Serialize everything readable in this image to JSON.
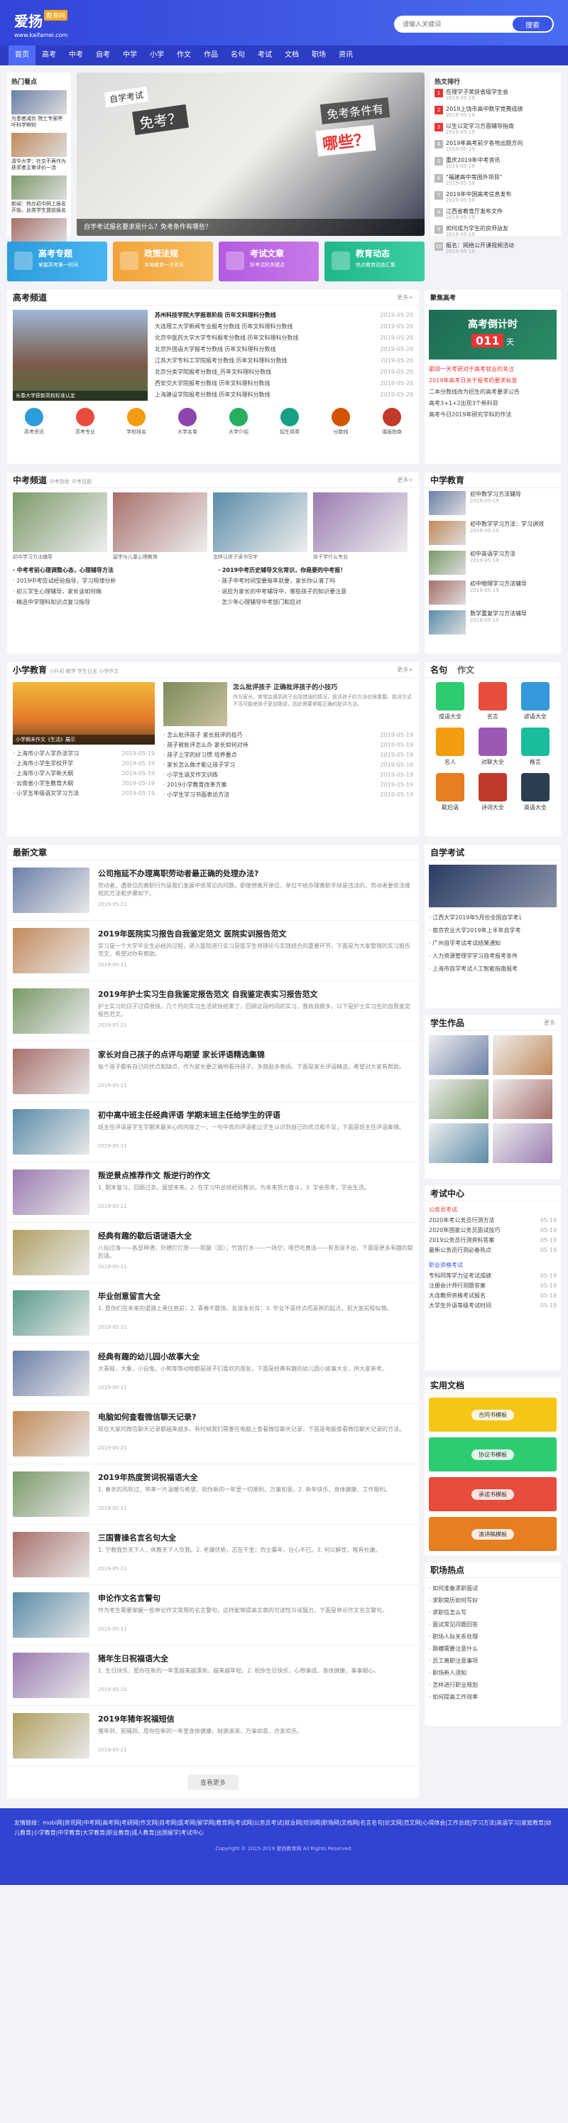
{
  "site": {
    "name": "爱扬",
    "tag": "教育网",
    "url": "www.kaifamei.com"
  },
  "search": {
    "placeholder": "请输入关键词",
    "button": "搜索"
  },
  "nav": [
    "首页",
    "高考",
    "中考",
    "自考",
    "中学",
    "小学",
    "作文",
    "作品",
    "名句",
    "考试",
    "文档",
    "职场",
    "资讯"
  ],
  "hot": {
    "title": "热门看点",
    "items": [
      {
        "t": "为患者减负 院士专家呼吁科学辨别"
      },
      {
        "t": "清华大学：社交不再作为获奖者主审评价一流"
      },
      {
        "t": "新闻：热办初中网上报名开始，此类学生提前报名"
      },
      {
        "t": "高考来啦招生名录省内哪些专业分数高"
      }
    ]
  },
  "banner": {
    "caption": "自学考试报名要求是什么？免考条件有哪些？",
    "line1": "自学考试",
    "line2": "免考？",
    "line3": "免考条件有",
    "line4": "哪些？"
  },
  "news_right": {
    "title": "热文排行",
    "items": [
      {
        "t": "在理学子荣获省级学生会",
        "d": "2019-05-19"
      },
      {
        "t": "2019上饶市高中数学竞赛成绩",
        "d": "2019-05-19"
      },
      {
        "t": "以生以定学习方面辅导指南",
        "d": "2019-05-19"
      },
      {
        "t": "2019年高考前夕各地出题方向",
        "d": "2019-05-19"
      },
      {
        "t": "重庆2019年中考资讯",
        "d": "2019-05-19"
      },
      {
        "t": "\"福建高中等国外项目\"",
        "d": "2019-05-19"
      },
      {
        "t": "2019年中国高考信息发布",
        "d": "2019-05-19"
      },
      {
        "t": "江西省教育厅发布文件",
        "d": "2019-05-19"
      },
      {
        "t": "如何成为学生的良师益友",
        "d": "2019-05-19"
      },
      {
        "t": "报名：网络公开课视频活动",
        "d": "2019-05-19"
      }
    ]
  },
  "quick": [
    {
      "t": "高考专题",
      "s": "掌握高考第一时间"
    },
    {
      "t": "政策法规",
      "s": "本地教育一手资讯"
    },
    {
      "t": "考试文章",
      "s": "好考试的关键点"
    },
    {
      "t": "教育动态",
      "s": "热点教育动态汇集"
    }
  ],
  "gaokao": {
    "title": "高考频道",
    "more": "更多+",
    "img_caption": "长春大学获新高校标准认定",
    "items": [
      {
        "t": "苏州科技学院大学报恩阶段 历年文科理科分数线",
        "d": "2019-05-20"
      },
      {
        "t": "大连理工大学新闻专业报考分数线 历年文科理科分数线",
        "d": "2019-05-20"
      },
      {
        "t": "北京中医药大学大学专科报考分数线 历年文科理科分数线",
        "d": "2019-05-20"
      },
      {
        "t": "北京外国语大学报考分数线 历年文科理科分数线",
        "d": "2019-05-20"
      },
      {
        "t": "江苏大学专科工学院报考分数线 历年文科理科分数线",
        "d": "2019-05-20"
      },
      {
        "t": "北京分类学院报考分数线_历年文科理科分数线",
        "d": "2019-05-20"
      },
      {
        "t": "西安交大学院报考分数线 历年文科理科分数线",
        "d": "2019-05-20"
      },
      {
        "t": "上海建设学院报考分数线 历年文科理科分数线",
        "d": "2019-05-20"
      }
    ],
    "icons": [
      "高考资讯",
      "高考专业",
      "学校排名",
      "大学名单",
      "大学介绍",
      "招生简章",
      "分数线",
      "填报指南"
    ]
  },
  "countdown": {
    "title": "聚焦高考",
    "label": "高考倒计时",
    "days": "011",
    "unit": "天",
    "items": [
      {
        "t": "歌颂一天考研对于高考就业的关注",
        "red": true
      },
      {
        "t": "2019年高考日关于留考的要求标准",
        "red": true
      },
      {
        "t": "二本分数线改为招生的高考要求公告",
        "red": false
      },
      {
        "t": "高考3+1+2出现3个新科目",
        "red": false
      },
      {
        "t": "高考今日2019年研究学科的作法",
        "red": false
      }
    ]
  },
  "zhongkao": {
    "title": "中考频道",
    "sub": [
      "中考指南",
      "中考百题"
    ],
    "more": "更多+",
    "pics": [
      "初中学习方法辅导",
      "留学与儿童心理教育",
      "怎样让孩子读书写字",
      "孩子学什么专业"
    ],
    "items": [
      {
        "t": "中考考前心理调整心态，心理辅导方法",
        "b": true
      },
      {
        "t": "2019中考应试经验指导，学习规律分析"
      },
      {
        "t": "初三学生心理辅导，家长该如何做"
      },
      {
        "t": "精选中学理科知识点复习指导"
      },
      {
        "t": "2019中考历史辅导文化常识，你是要的中考报！",
        "b": true
      },
      {
        "t": "孩子中考时间宝要每年就要，家长你认清了吗"
      },
      {
        "t": "说应为家长的中考辅导中，哪些孩子的知识要注意"
      },
      {
        "t": "怎少年心理辅导中考部门和应对"
      }
    ]
  },
  "zhongxue": {
    "title": "中学教育",
    "items": [
      {
        "t": "初中数学习方法辅导",
        "d": "2019-05-19"
      },
      {
        "t": "初中数学学习方法：学习讲效",
        "d": "2019-05-19"
      },
      {
        "t": "初中英语学习方法",
        "d": "2019-05-19"
      },
      {
        "t": "初中物理学习方法辅导",
        "d": "2019-05-19"
      },
      {
        "t": "数学重复学习方法辅导",
        "d": "2019-05-19"
      }
    ]
  },
  "xiaoxue": {
    "title": "小学教育",
    "sub": [
      "小升初",
      "教学",
      "学生日志",
      "小学作文"
    ],
    "more": "更多+",
    "feature": {
      "t": "怎么批评孩子 正确批评孩子的小技巧",
      "s": "作为家长，常常会遇到孩子出现错误的情况，批评孩子的方法也很重要。批评方式不当可能使孩子更加叛逆，因此需要掌握正确的批评方法。"
    },
    "img_caption": "小学期末作文《生活》展示",
    "left": [
      {
        "t": "上海市小学入学办法学习",
        "d": "2019-05-19"
      },
      {
        "t": "上海市小学生学校开学",
        "d": "2019-05-19"
      },
      {
        "t": "上海市小学入学新大纲",
        "d": "2019-05-19"
      },
      {
        "t": "云南省小学生教育大纲",
        "d": "2019-05-19"
      },
      {
        "t": "小学五年级语文学习方法",
        "d": "2019-05-19"
      }
    ],
    "right": [
      {
        "t": "怎么批评孩子 家长批评的技巧",
        "d": "2019-05-19"
      },
      {
        "t": "孩子被批评怎么办 家长如何对待",
        "d": "2019-05-19"
      },
      {
        "t": "孩子上学的好习惯 培养要点",
        "d": "2019-05-19"
      },
      {
        "t": "家长怎么做才能让孩子学习",
        "d": "2019-05-19"
      },
      {
        "t": "小学生语文作文训练",
        "d": "2019-05-19"
      },
      {
        "t": "2019小学教育改革方案",
        "d": "2019-05-19"
      },
      {
        "t": "小学生学习书面表达方法",
        "d": "2019-05-19"
      }
    ]
  },
  "mingju": {
    "tabs": [
      "名句",
      "作文"
    ],
    "items": [
      "成语大全",
      "名言",
      "谚语大全",
      "名人",
      "对联大全",
      "格言",
      "歇后语",
      "诗词大全",
      "英语大全"
    ]
  },
  "latest": {
    "title": "最新文章",
    "items": [
      {
        "t": "公司拖延不办理离职劳动者最正确的处理办法?",
        "s": "劳动者，遇单位的离职行为是我们发展中很常见的问题，即使想离开单位，单位不给办理离职手续是违法的，劳动者要依法维权的方法和步骤如下。",
        "d": "2019-05-21"
      },
      {
        "t": "2019年医院实习报告自我鉴定范文 医院实训报告范文",
        "s": "实习是一个大学毕业生必经的过程，进入医院进行实习是医学生将理论与实践结合的重要环节。下面是为大家整理的实习报告范文，希望对你有帮助。",
        "d": "2019-05-21"
      },
      {
        "t": "2019年护士实习生自我鉴定报告范文 自我鉴定表实习报告范文",
        "s": "护士实习的日子过得很快，几个月的实习生活就快结束了，回顾这段时间的实习，我收获颇多，以下是护士实习生的自我鉴定报告范文。",
        "d": "2019-05-21"
      },
      {
        "t": "家长对自己孩子的点评与期望 家长评语精选集锦",
        "s": "每个孩子都有自己的优点和缺点，作为家长要正确地看待孩子，多鼓励多表扬。下面是家长评语精选，希望对大家有帮助。",
        "d": "2019-05-21"
      },
      {
        "t": "初中高中班主任经典评语 学期末班主任给学生的评语",
        "s": "班主任评语是学生学期末最关心的内容之一，一句中肯的评语能让学生认识到自己的优点和不足，下面是班主任评语集锦。",
        "d": "2019-05-21"
      },
      {
        "t": "叛逆景点推荐作文 叛逆行的作文",
        "s": "1. 期末复习，回顾过去，展望未来。2. 在学习中总结经验教训，为未来努力奋斗，3. 学会思考，学会生活。",
        "d": "2019-05-21"
      },
      {
        "t": "经典有趣的歇后语谜语大全",
        "s": "八仙过海——各显神通；外甥打灯笼——照舅（旧）；竹篮打水——一场空；哑巴吃黄连——有苦说不出，下面是更多有趣的歇后语。",
        "d": "2019-05-21"
      },
      {
        "t": "毕业创意留言大全",
        "s": "1. 愿你们在未来的道路上勇往直前；2. 青春不散场，友谊永长存；3. 毕业不是终点而是新的起点，祝大家前程似锦。",
        "d": "2019-05-21"
      },
      {
        "t": "经典有趣的幼儿园小故事大全",
        "s": "大青蛙，大象，小白兔，小熊等等动物都是孩子们喜欢的朋友，下面是经典有趣的幼儿园小故事大全，供大家参考。",
        "d": "2019-05-21"
      },
      {
        "t": "电脑如何查看微信聊天记录?",
        "s": "现在大家的微信聊天记录都越来越多，有时候我们需要在电脑上查看微信聊天记录，下面是电脑查看微信聊天记录的方法。",
        "d": "2019-05-21"
      },
      {
        "t": "2019年热度贺词祝福语大全",
        "s": "1. 春天的风吹过，带来一片温暖与希望，祝你新的一年里一切顺利，万事如意。2. 新年快乐，身体健康，工作顺利。",
        "d": "2019-05-21"
      },
      {
        "t": "三国曹操名言名句大全",
        "s": "1. 宁教我负天下人，休教天下人负我。2. 老骥伏枥，志在千里；烈士暮年，壮心不已。3. 何以解忧，唯有杜康。",
        "d": "2019-05-21"
      },
      {
        "t": "申论作文名言警句",
        "s": "作为考生需要掌握一些申论作文常用的名言警句，这样能够提高文章的可读性与说服力，下面是申论作文名言警句。",
        "d": "2019-05-21"
      },
      {
        "t": "猪年生日祝福语大全",
        "s": "1. 生日快乐，愿你在新的一年里越来越漂亮，越来越年轻。2. 祝你生日快乐，心想事成，身体健康，事事顺心。",
        "d": "2019-05-21"
      },
      {
        "t": "2019年猪年祝福短信",
        "s": "猪年到，祝福到，愿你在新的一年里身体健康，财源滚滚，万事如意，合家欢乐。",
        "d": "2019-05-21"
      }
    ],
    "more_btn": "查看更多"
  },
  "zikao": {
    "title": "自学考试",
    "items": [
      {
        "t": "江西大学2019年5月份全国自学考试",
        "d": "2019-05-19"
      },
      {
        "t": "南京农业大学2019年上半年自学考试",
        "d": "2019-05-19"
      },
      {
        "t": "广州自学考试考试结果通知",
        "d": "2019-05-19"
      },
      {
        "t": "人力资源管理学学习自考报考条件",
        "d": "2019-05-19"
      },
      {
        "t": "上海市自学考试人工智能指南报考",
        "d": "2019-05-19"
      }
    ]
  },
  "works": {
    "title": "学生作品",
    "more": "更多"
  },
  "kaoshi": {
    "title": "考试中心",
    "g1": "公务员考试",
    "items1": [
      {
        "t": "2020年考公务员行测方法",
        "d": "05-19"
      },
      {
        "t": "2020年国家公务员面试技巧",
        "d": "05-19"
      },
      {
        "t": "2019公务员行测资料答案",
        "d": "05-19"
      },
      {
        "t": "最新公务员行测必备热点",
        "d": "05-19"
      }
    ],
    "g2": "职业资格考试",
    "items2": [
      {
        "t": "专科同等学力证考试成绩",
        "d": "05-19"
      },
      {
        "t": "注册会计师行测题答案",
        "d": "05-19"
      },
      {
        "t": "大连教师资格考试报名",
        "d": "05-19"
      },
      {
        "t": "大学生外语等级考试时间",
        "d": "05-19"
      }
    ]
  },
  "docs": {
    "title": "实用文档",
    "items": [
      "合同书模板",
      "协议书模板",
      "承诺书模板",
      "演讲稿模板"
    ]
  },
  "career": {
    "title": "职场热点",
    "items": [
      "如何准备求职面试",
      "求职简历如何写好",
      "求职信怎么写",
      "面试常见问题回答",
      "职场人际关系处理",
      "跳槽需要注意什么",
      "员工离职注意事项",
      "职场新人须知",
      "怎样进行职业规划",
      "如何提高工作效率"
    ]
  },
  "footer": {
    "links": "友情链接：mobi网|资讯网|中考网|高考网|考研网|作文网|自考网|医考网|留学网|教育网|考试网|公务员考试|就业网|培训网|职场网|文档网|名言名句|论文网|范文网|心得体会|工作总结|学习方法|英语学习|家庭教育|幼儿教育|小学教育|中学教育|大学教育|职业教育|成人教育|出国留学|考试中心",
    "copy": "Copyright © 2015-2019 爱扬教育网 All Rights Reserved."
  }
}
